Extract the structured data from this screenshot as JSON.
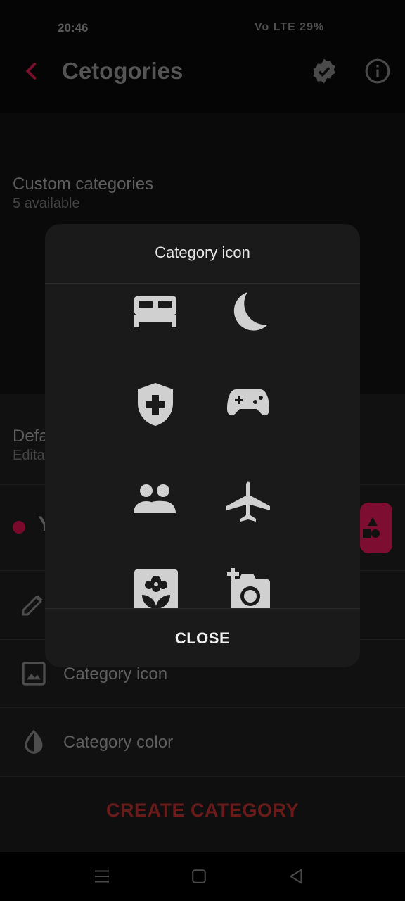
{
  "status_bar": {
    "time": "20:46",
    "indicators": "Vo LTE 29%"
  },
  "app_bar": {
    "title": "Cetogories",
    "back_icon": "back-arrow-icon",
    "verified_icon": "verified-badge-icon",
    "info_icon": "info-icon"
  },
  "custom_section": {
    "title": "Custom categories",
    "subtitle": "5 available"
  },
  "default_section": {
    "title": "Defa",
    "subtitle": "Edita"
  },
  "category_row": {
    "label": "Y"
  },
  "options": [
    {
      "label": "Category icon",
      "icon": "image-icon"
    },
    {
      "label": "Category color",
      "icon": "contrast-drop-icon"
    }
  ],
  "create_button": {
    "label": "CREATE CATEGORY"
  },
  "dialog": {
    "title": "Category icon",
    "close_label": "CLOSE",
    "icons": [
      "bed-icon",
      "moon-icon",
      "medical-shield-icon",
      "gamepad-icon",
      "people-icon",
      "airplane-icon",
      "flower-photo-icon",
      "add-camera-icon"
    ]
  },
  "colors": {
    "accent": "#c2185b",
    "create_text": "#6b1a1a",
    "dialog_bg": "#1a1a1a",
    "icon_fill": "#d0d0d0"
  }
}
